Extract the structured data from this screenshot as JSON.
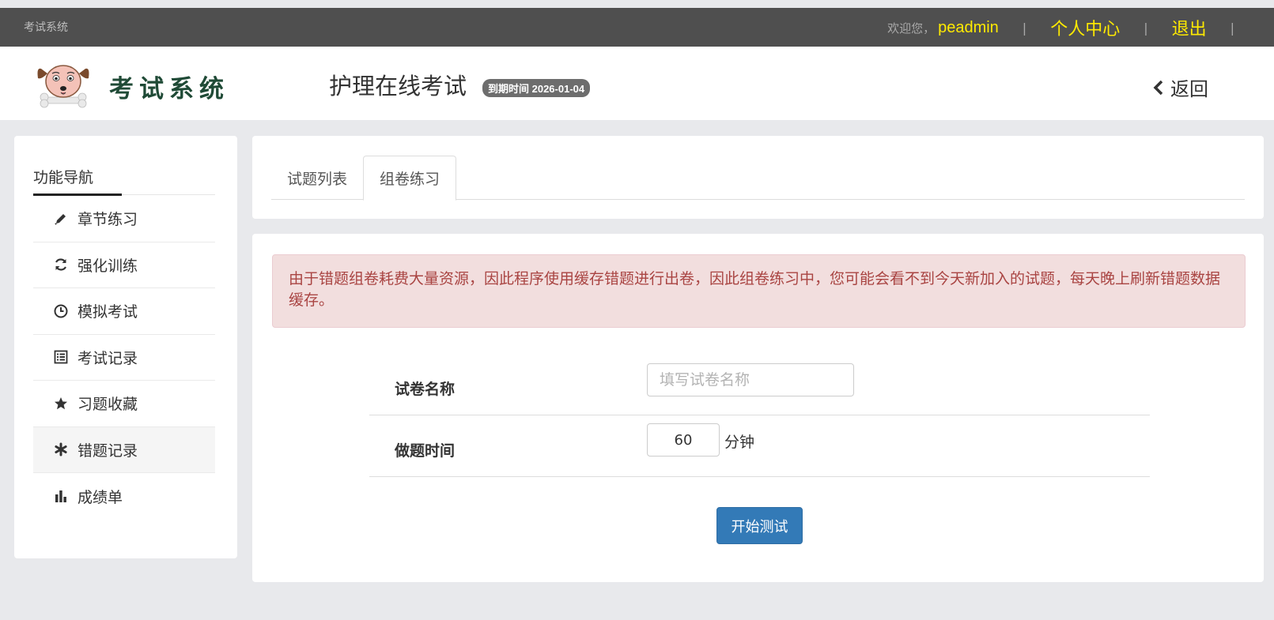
{
  "topbar": {
    "system_name": "考试系统",
    "welcome": "欢迎您，",
    "username": "peadmin",
    "separator": "|",
    "profile_link": "个人中心",
    "logout_link": "退出"
  },
  "header": {
    "logo_text": "考试系统",
    "page_title": "护理在线考试",
    "expire_badge": "到期时间 2026-01-04",
    "back_label": "返回"
  },
  "sidebar": {
    "title": "功能导航",
    "items": [
      {
        "label": "章节练习",
        "icon": "pencil-icon"
      },
      {
        "label": "强化训练",
        "icon": "refresh-icon"
      },
      {
        "label": "模拟考试",
        "icon": "clock-icon"
      },
      {
        "label": "考试记录",
        "icon": "list-alt-icon"
      },
      {
        "label": "习题收藏",
        "icon": "star-icon"
      },
      {
        "label": "错题记录",
        "icon": "asterisk-icon",
        "active": true
      },
      {
        "label": "成绩单",
        "icon": "bar-chart-icon"
      }
    ]
  },
  "tabs": [
    {
      "label": "试题列表",
      "active": false
    },
    {
      "label": "组卷练习",
      "active": true
    }
  ],
  "alert": {
    "text": "由于错题组卷耗费大量资源，因此程序使用缓存错题进行出卷，因此组卷练习中，您可能会看不到今天新加入的试题，每天晚上刷新错题数据缓存。"
  },
  "form": {
    "name_label": "试卷名称",
    "name_placeholder": "填写试卷名称",
    "time_label": "做题时间",
    "time_value": "60",
    "time_unit": "分钟",
    "submit_label": "开始测试"
  },
  "colors": {
    "topbar_bg": "#4f4f4f",
    "topbar_link": "#ffea00",
    "primary": "#337ab7",
    "alert_bg": "#f2dede",
    "alert_text": "#a94442"
  }
}
